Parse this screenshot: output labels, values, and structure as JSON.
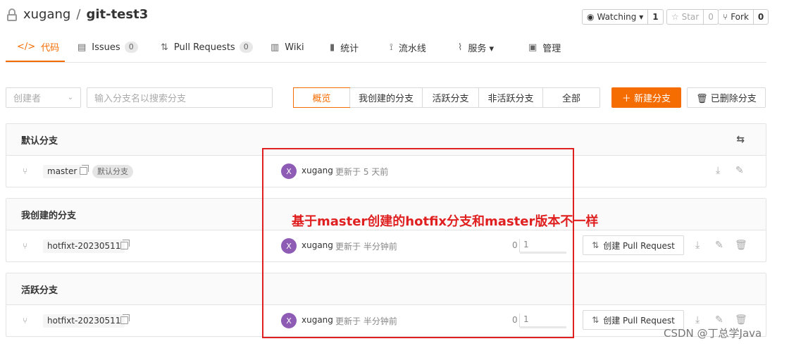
{
  "repo": {
    "owner": "xugang",
    "separator": "/",
    "name": "git-test3"
  },
  "social": {
    "watching_label": "Watching ▾",
    "watching_count": "1",
    "star_label": "☆ Star",
    "star_count": "0",
    "fork_label": "Fork",
    "fork_count": "0"
  },
  "tabs": [
    {
      "icon": "</>",
      "label": "代码"
    },
    {
      "icon": "▤",
      "label": "Issues",
      "badge": "0"
    },
    {
      "icon": "⇅",
      "label": "Pull Requests",
      "badge": "0"
    },
    {
      "icon": "▥",
      "label": "Wiki"
    },
    {
      "icon": "▮",
      "label": "统计"
    },
    {
      "icon": "⟟",
      "label": "流水线"
    },
    {
      "icon": "⌇",
      "label": "服务 ▾"
    },
    {
      "icon": "▣",
      "label": "管理"
    }
  ],
  "filters": {
    "creator_placeholder": "创建者",
    "search_placeholder": "输入分支名以搜索分支"
  },
  "segments": [
    "概览",
    "我创建的分支",
    "活跃分支",
    "非活跃分支",
    "全部"
  ],
  "actions": {
    "new_branch": "＋ 新建分支",
    "deleted_branches": "🗑 已删除分支"
  },
  "sections": [
    {
      "title": "默认分支",
      "row": {
        "branch": "master",
        "tag": "默认分支",
        "avatar": "X",
        "author": "xugang",
        "updated": "更新于 5 天前"
      }
    },
    {
      "title": "我创建的分支",
      "row": {
        "branch": "hotfixt-20230511",
        "avatar": "X",
        "author": "xugang",
        "updated": "更新于 半分钟前",
        "ahead": "0",
        "behind": "1",
        "pr": "创建 Pull Request"
      }
    },
    {
      "title": "活跃分支",
      "row": {
        "branch": "hotfixt-20230511",
        "avatar": "X",
        "author": "xugang",
        "updated": "更新于 半分钟前",
        "ahead": "0",
        "behind": "1",
        "pr": "创建 Pull Request"
      }
    }
  ],
  "annotation": "基于master创建的hotfix分支和master版本不一样",
  "watermark": "CSDN @丁总学Java",
  "colors": {
    "accent": "#f56c00",
    "annotation": "#e02020",
    "avatar": "#8e5bb5"
  }
}
